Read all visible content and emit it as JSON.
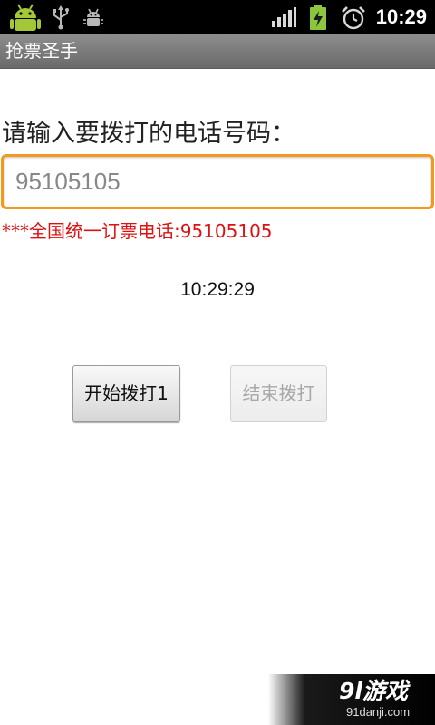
{
  "status_bar": {
    "time": "10:29",
    "left_icons": [
      "android-icon",
      "usb-icon",
      "debug-icon"
    ],
    "right_icons": [
      "signal-icon",
      "battery-charging-icon",
      "alarm-icon"
    ]
  },
  "title_bar": {
    "title": "抢票圣手"
  },
  "main": {
    "prompt_label": "请输入要拨打的电话号码：",
    "phone_input_value": "95105105",
    "hint": "***全国统一订票电话:95105105",
    "clock": "10:29:29",
    "start_button_label": "开始拨打1",
    "end_button_label": "结束拨打"
  },
  "watermark": {
    "logo_text": "9l游戏",
    "url": "91danji.com"
  },
  "colors": {
    "input_focus_border": "#f39a1e",
    "hint_text": "#dd1111",
    "status_bar_bg": "#000000",
    "title_bar_bg": "#7a7a7a",
    "android_green": "#a4c639",
    "battery_green": "#8cc63f"
  }
}
